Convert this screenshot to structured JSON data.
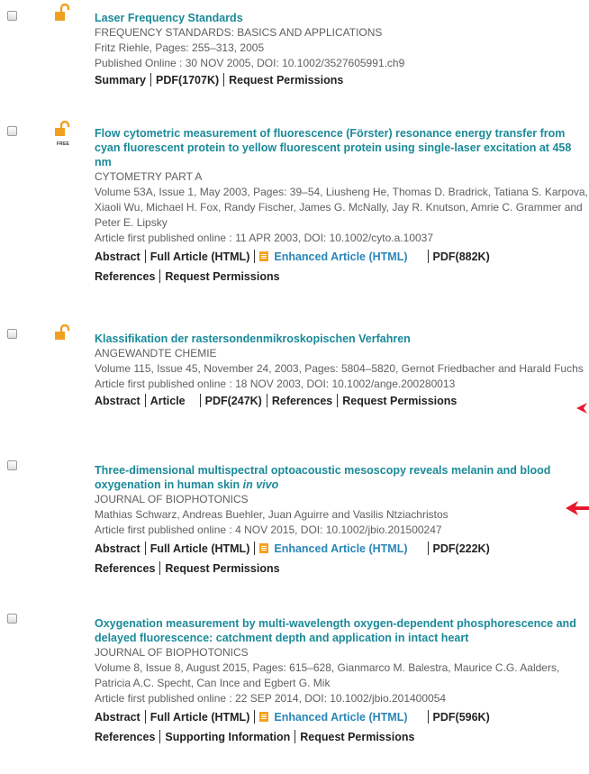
{
  "entries": [
    {
      "title": "Laser Frequency Standards",
      "source": "FREQUENCY STANDARDS: BASICS AND APPLICATIONS",
      "details": "Fritz Riehle, Pages: 255–313, 2005",
      "published": "Published Online : 30 NOV 2005, DOI: 10.1002/3527605991.ch9",
      "links": [
        "Summary",
        "PDF(1707K)",
        "Request Permissions"
      ],
      "icon": "open-access-lock-icon"
    },
    {
      "title": "Flow cytometric measurement of fluorescence (Förster) resonance energy transfer from cyan fluorescent protein to yellow fluorescent protein using single-laser excitation at 458 nm",
      "source": "CYTOMETRY PART A",
      "details": "Volume 53A, Issue 1, May 2003, Pages: 39–54, Liusheng He, Thomas D. Bradrick, Tatiana S. Karpova, Xiaoli Wu, Michael H. Fox, Randy Fischer, James G. McNally, Jay R. Knutson, Amrie C. Grammer and Peter E. Lipsky",
      "published": "Article first published online : 11 APR 2003, DOI: 10.1002/cyto.a.10037",
      "links": [
        "Abstract",
        "Full Article (HTML)",
        "Enhanced Article (HTML)",
        "PDF(882K)",
        "References",
        "Request Permissions"
      ],
      "icon": "free-access-lock-icon",
      "icon_label": "FREE"
    },
    {
      "title": "Klassifikation der rastersondenmikroskopischen Verfahren",
      "source": "ANGEWANDTE CHEMIE",
      "details": "Volume 115, Issue 45, November 24, 2003, Pages: 5804–5820, Gernot Friedbacher and Harald Fuchs",
      "published": "Article first published online : 18 NOV 2003, DOI: 10.1002/ange.200280013",
      "links": [
        "Abstract",
        "Article",
        "PDF(247K)",
        "References",
        "Request Permissions"
      ],
      "icon": "open-access-lock-icon"
    },
    {
      "title_main": "Three-dimensional multispectral optoacoustic mesoscopy reveals melanin and blood oxygenation in human skin ",
      "title_italic": "in vivo",
      "source": "JOURNAL OF BIOPHOTONICS",
      "details": "Mathias Schwarz, Andreas Buehler, Juan Aguirre and Vasilis Ntziachristos",
      "published": "Article first published online : 4 NOV 2015, DOI: 10.1002/jbio.201500247",
      "links": [
        "Abstract",
        "Full Article (HTML)",
        "Enhanced Article (HTML)",
        "PDF(222K)",
        "References",
        "Request Permissions"
      ]
    },
    {
      "title": "Oxygenation measurement by multi-wavelength oxygen-dependent phosphorescence and delayed fluorescence: catchment depth and application in intact heart",
      "source": "JOURNAL OF BIOPHOTONICS",
      "details": "Volume 8, Issue 8, August 2015, Pages: 615–628, Gianmarco M. Balestra, Maurice C.G. Aalders, Patricia A.C. Specht, Can Ince and Egbert G. Mik",
      "published": "Article first published online : 22 SEP 2014, DOI: 10.1002/jbio.201400054",
      "links": [
        "Abstract",
        "Full Article (HTML)",
        "Enhanced Article (HTML)",
        "PDF(596K)",
        "References",
        "Supporting Information",
        "Request Permissions"
      ]
    }
  ],
  "colors": {
    "title": "#1a8a99",
    "link_blue": "#2a86b8",
    "lock": "#f0a01f",
    "arrow": "#e8192c",
    "enhanced_icon": "#f5a11c"
  }
}
